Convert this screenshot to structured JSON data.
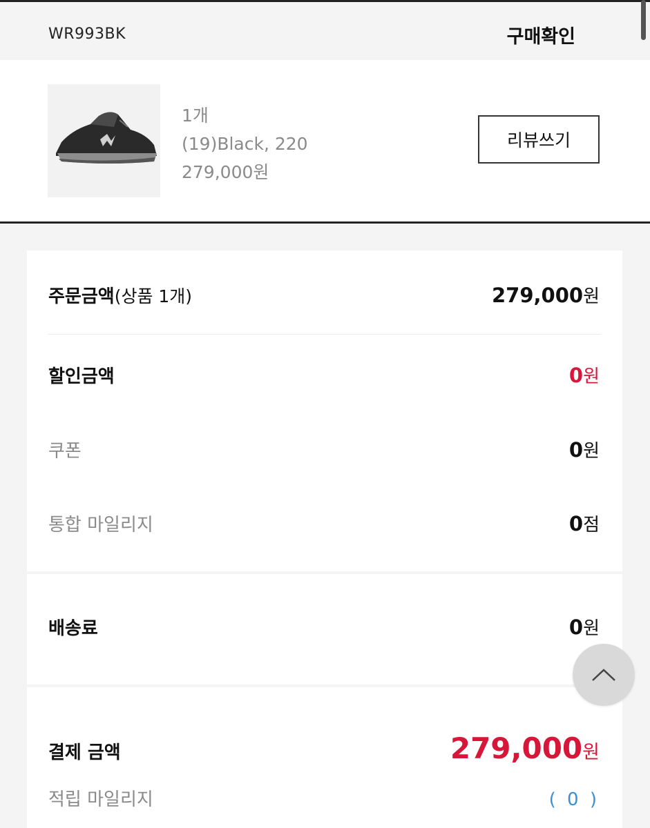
{
  "header": {
    "model": "WR993BK",
    "action": "구매확인"
  },
  "product": {
    "image_alt": "black-sneaker-image",
    "quantity": "1개",
    "option": "(19)Black, 220",
    "price": "279,000원",
    "review_label": "리뷰쓰기"
  },
  "summary": {
    "order_label": "주문금액",
    "order_sub": "(상품 1개)",
    "order_amount": "279,000",
    "order_unit": "원",
    "discount_label": "할인금액",
    "discount_amount": "0",
    "discount_unit": "원",
    "coupon_label": "쿠폰",
    "coupon_amount": "0",
    "coupon_unit": "원",
    "mileage_label": "통합 마일리지",
    "mileage_amount": "0",
    "mileage_unit": "점"
  },
  "shipping": {
    "label": "배송료",
    "amount": "0",
    "unit": "원"
  },
  "payment": {
    "label": "결제 금액",
    "amount": "279,000",
    "unit": "원",
    "earn_label": "적립 마일리지",
    "earn_value": "( 0 )"
  },
  "colors": {
    "accent_red": "#d6173a",
    "link_blue": "#3b8fd6"
  }
}
